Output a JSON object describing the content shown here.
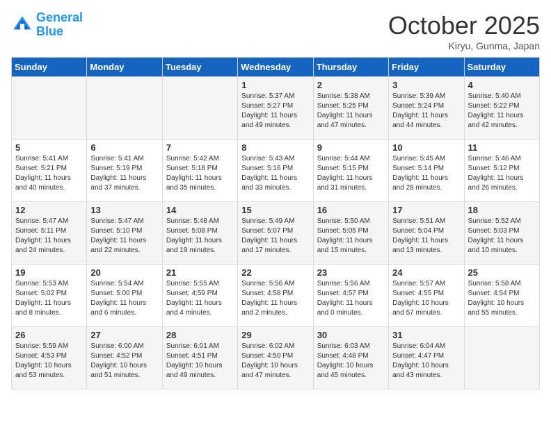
{
  "logo": {
    "line1": "General",
    "line2": "Blue"
  },
  "title": "October 2025",
  "location": "Kiryu, Gunma, Japan",
  "days_of_week": [
    "Sunday",
    "Monday",
    "Tuesday",
    "Wednesday",
    "Thursday",
    "Friday",
    "Saturday"
  ],
  "weeks": [
    [
      {
        "day": "",
        "info": ""
      },
      {
        "day": "",
        "info": ""
      },
      {
        "day": "",
        "info": ""
      },
      {
        "day": "1",
        "info": "Sunrise: 5:37 AM\nSunset: 5:27 PM\nDaylight: 11 hours\nand 49 minutes."
      },
      {
        "day": "2",
        "info": "Sunrise: 5:38 AM\nSunset: 5:25 PM\nDaylight: 11 hours\nand 47 minutes."
      },
      {
        "day": "3",
        "info": "Sunrise: 5:39 AM\nSunset: 5:24 PM\nDaylight: 11 hours\nand 44 minutes."
      },
      {
        "day": "4",
        "info": "Sunrise: 5:40 AM\nSunset: 5:22 PM\nDaylight: 11 hours\nand 42 minutes."
      }
    ],
    [
      {
        "day": "5",
        "info": "Sunrise: 5:41 AM\nSunset: 5:21 PM\nDaylight: 11 hours\nand 40 minutes."
      },
      {
        "day": "6",
        "info": "Sunrise: 5:41 AM\nSunset: 5:19 PM\nDaylight: 11 hours\nand 37 minutes."
      },
      {
        "day": "7",
        "info": "Sunrise: 5:42 AM\nSunset: 5:18 PM\nDaylight: 11 hours\nand 35 minutes."
      },
      {
        "day": "8",
        "info": "Sunrise: 5:43 AM\nSunset: 5:16 PM\nDaylight: 11 hours\nand 33 minutes."
      },
      {
        "day": "9",
        "info": "Sunrise: 5:44 AM\nSunset: 5:15 PM\nDaylight: 11 hours\nand 31 minutes."
      },
      {
        "day": "10",
        "info": "Sunrise: 5:45 AM\nSunset: 5:14 PM\nDaylight: 11 hours\nand 28 minutes."
      },
      {
        "day": "11",
        "info": "Sunrise: 5:46 AM\nSunset: 5:12 PM\nDaylight: 11 hours\nand 26 minutes."
      }
    ],
    [
      {
        "day": "12",
        "info": "Sunrise: 5:47 AM\nSunset: 5:11 PM\nDaylight: 11 hours\nand 24 minutes."
      },
      {
        "day": "13",
        "info": "Sunrise: 5:47 AM\nSunset: 5:10 PM\nDaylight: 11 hours\nand 22 minutes."
      },
      {
        "day": "14",
        "info": "Sunrise: 5:48 AM\nSunset: 5:08 PM\nDaylight: 11 hours\nand 19 minutes."
      },
      {
        "day": "15",
        "info": "Sunrise: 5:49 AM\nSunset: 5:07 PM\nDaylight: 11 hours\nand 17 minutes."
      },
      {
        "day": "16",
        "info": "Sunrise: 5:50 AM\nSunset: 5:05 PM\nDaylight: 11 hours\nand 15 minutes."
      },
      {
        "day": "17",
        "info": "Sunrise: 5:51 AM\nSunset: 5:04 PM\nDaylight: 11 hours\nand 13 minutes."
      },
      {
        "day": "18",
        "info": "Sunrise: 5:52 AM\nSunset: 5:03 PM\nDaylight: 11 hours\nand 10 minutes."
      }
    ],
    [
      {
        "day": "19",
        "info": "Sunrise: 5:53 AM\nSunset: 5:02 PM\nDaylight: 11 hours\nand 8 minutes."
      },
      {
        "day": "20",
        "info": "Sunrise: 5:54 AM\nSunset: 5:00 PM\nDaylight: 11 hours\nand 6 minutes."
      },
      {
        "day": "21",
        "info": "Sunrise: 5:55 AM\nSunset: 4:59 PM\nDaylight: 11 hours\nand 4 minutes."
      },
      {
        "day": "22",
        "info": "Sunrise: 5:56 AM\nSunset: 4:58 PM\nDaylight: 11 hours\nand 2 minutes."
      },
      {
        "day": "23",
        "info": "Sunrise: 5:56 AM\nSunset: 4:57 PM\nDaylight: 11 hours\nand 0 minutes."
      },
      {
        "day": "24",
        "info": "Sunrise: 5:57 AM\nSunset: 4:55 PM\nDaylight: 10 hours\nand 57 minutes."
      },
      {
        "day": "25",
        "info": "Sunrise: 5:58 AM\nSunset: 4:54 PM\nDaylight: 10 hours\nand 55 minutes."
      }
    ],
    [
      {
        "day": "26",
        "info": "Sunrise: 5:59 AM\nSunset: 4:53 PM\nDaylight: 10 hours\nand 53 minutes."
      },
      {
        "day": "27",
        "info": "Sunrise: 6:00 AM\nSunset: 4:52 PM\nDaylight: 10 hours\nand 51 minutes."
      },
      {
        "day": "28",
        "info": "Sunrise: 6:01 AM\nSunset: 4:51 PM\nDaylight: 10 hours\nand 49 minutes."
      },
      {
        "day": "29",
        "info": "Sunrise: 6:02 AM\nSunset: 4:50 PM\nDaylight: 10 hours\nand 47 minutes."
      },
      {
        "day": "30",
        "info": "Sunrise: 6:03 AM\nSunset: 4:48 PM\nDaylight: 10 hours\nand 45 minutes."
      },
      {
        "day": "31",
        "info": "Sunrise: 6:04 AM\nSunset: 4:47 PM\nDaylight: 10 hours\nand 43 minutes."
      },
      {
        "day": "",
        "info": ""
      }
    ]
  ]
}
